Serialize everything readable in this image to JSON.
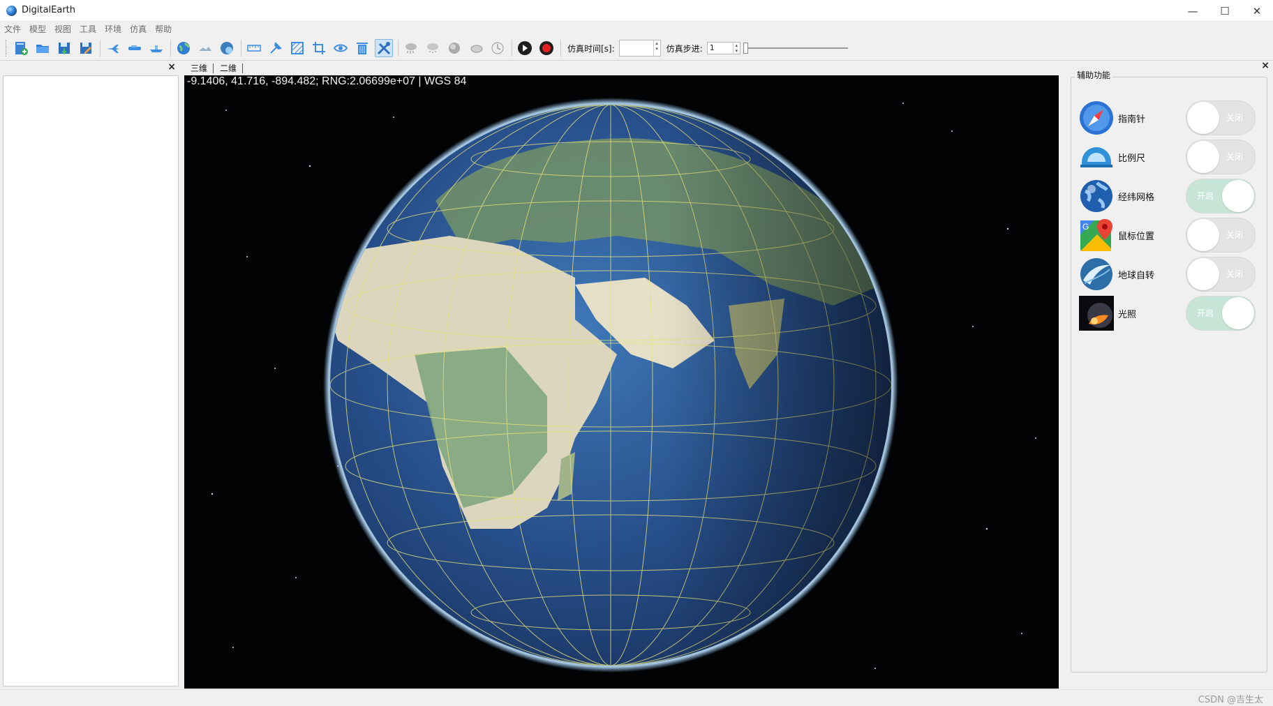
{
  "window": {
    "title": "DigitalEarth",
    "minimize": "—",
    "maximize": "☐",
    "close": "✕"
  },
  "menu": [
    "文件",
    "模型",
    "视图",
    "工具",
    "环境",
    "仿真",
    "帮助"
  ],
  "toolbar": {
    "sim_time_label": "仿真时间[s]:",
    "sim_time_value": "",
    "sim_step_label": "仿真步进:",
    "sim_step_value": "1",
    "sim_progress": 0.0
  },
  "left_panel": {
    "close": "×"
  },
  "view_tabs": [
    "三维",
    "二维"
  ],
  "viewport": {
    "coords": "-9.1406, 41.716, -894.482; RNG:2.06699e+07  |  WGS 84"
  },
  "right_panel": {
    "close": "×",
    "group_title": "辅助功能",
    "features": [
      {
        "label": "指南针",
        "state": "关闭",
        "on": false,
        "icon": "compass-icon"
      },
      {
        "label": "比例尺",
        "state": "关闭",
        "on": false,
        "icon": "scale-ruler-icon"
      },
      {
        "label": "经纬网格",
        "state": "开启",
        "on": true,
        "icon": "globe-grid-icon"
      },
      {
        "label": "鼠标位置",
        "state": "关闭",
        "on": false,
        "icon": "map-pin-icon"
      },
      {
        "label": "地球自转",
        "state": "关闭",
        "on": false,
        "icon": "earth-rotation-icon"
      },
      {
        "label": "光照",
        "state": "开启",
        "on": true,
        "icon": "sunlight-icon"
      }
    ]
  },
  "status": {
    "watermark": "CSDN @吉生太"
  },
  "colors": {
    "toggle_on": "#c7e5d6",
    "toggle_off": "#e3e3e3",
    "accent": "#2f7fd6"
  }
}
